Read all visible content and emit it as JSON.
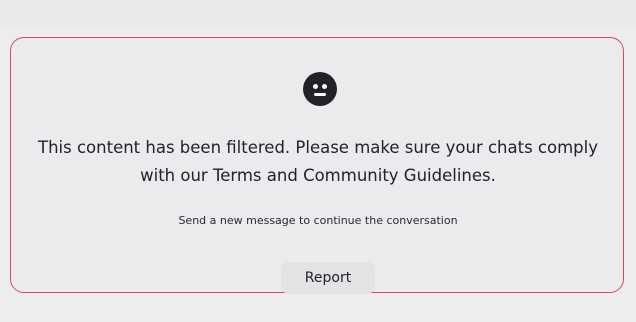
{
  "filter_notice": {
    "icon": "neutral-face-icon",
    "message_line1": "This content has been filtered. Please make sure your chats comply",
    "message_line2": "with our Terms and Community Guidelines.",
    "hint": "Send a new message to continue the conversation",
    "report_label": "Report"
  },
  "colors": {
    "border": "#d9495a",
    "background": "#ebebed",
    "icon": "#222227",
    "text": "#222227"
  }
}
